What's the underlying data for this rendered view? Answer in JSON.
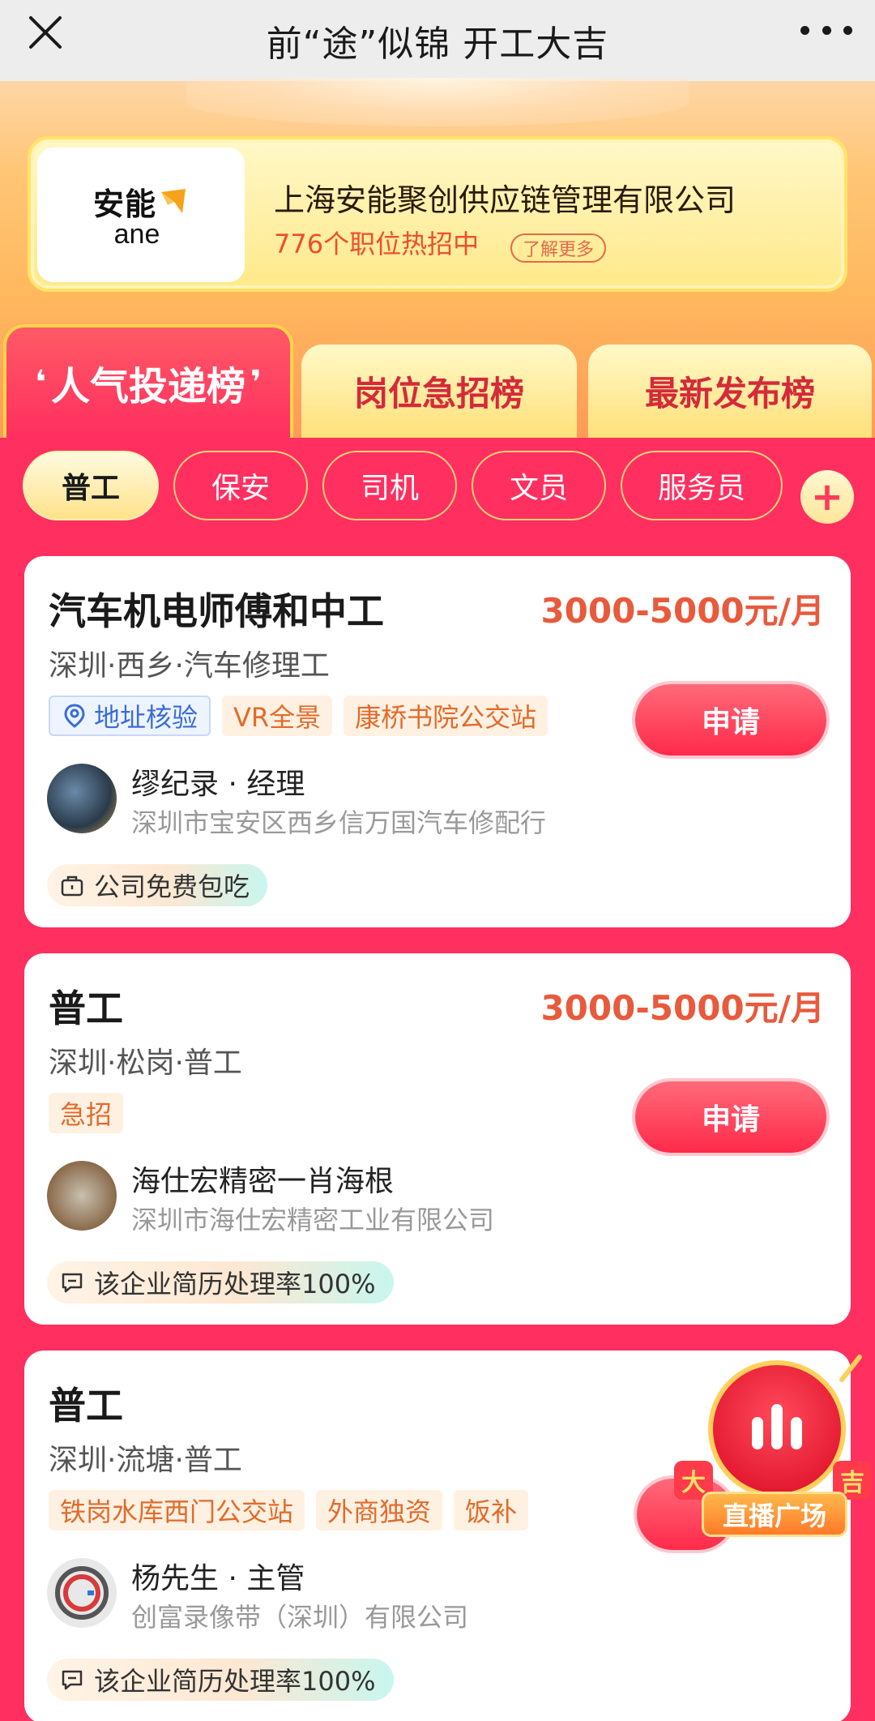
{
  "navbar": {
    "title": "前“途”似锦 开工大吉"
  },
  "banner": {
    "logo_cn": "安能",
    "logo_en": "ane",
    "company_name": "上海安能聚创供应链管理有限公司",
    "jobs_count_text": "776个职位热招中",
    "learn_more": "了解更多"
  },
  "rank_tabs": [
    {
      "label": "人气投递榜",
      "active": true
    },
    {
      "label": "岗位急招榜",
      "active": false
    },
    {
      "label": "最新发布榜",
      "active": false
    }
  ],
  "filters": [
    "普工",
    "保安",
    "司机",
    "文员",
    "服务员"
  ],
  "filters_add": "+",
  "jobs": [
    {
      "title": "汽车机电师傅和中工",
      "salary": "3000-5000元/月",
      "location": "深圳·西乡·汽车修理工",
      "tags": [
        "地址核验",
        "VR全景",
        "康桥书院公交站"
      ],
      "apply": "申请",
      "recruiter": "缪纪录 · 经理",
      "company": "深圳市宝安区西乡信万国汽车修配行",
      "perk": "公司免费包吃"
    },
    {
      "title": "普工",
      "salary": "3000-5000元/月",
      "location": "深圳·松岗·普工",
      "tags": [
        "急招"
      ],
      "apply": "申请",
      "recruiter": "海仕宏精密一肖海根",
      "company": "深圳市海仕宏精密工业有限公司",
      "perk": "该企业简历处理率100%"
    },
    {
      "title": "普工",
      "salary": "",
      "location": "深圳·流塘·普工",
      "tags": [
        "铁岗水库西门公交站",
        "外商独资",
        "饭补"
      ],
      "apply": "",
      "recruiter": "杨先生 · 主管",
      "company": "创富录像带（深圳）有限公司",
      "perk": "该企业简历处理率100%"
    }
  ],
  "live": {
    "label": "直播广场",
    "left_char": "大",
    "right_char": "吉"
  },
  "colors": {
    "page_bg": "#ff2f5f",
    "salary": "#e85a3c",
    "accent_yellow": "#ffe07a"
  }
}
